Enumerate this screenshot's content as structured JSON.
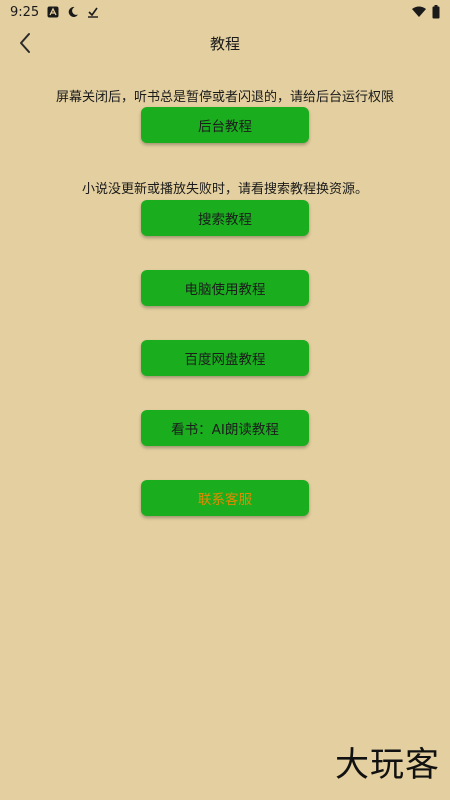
{
  "status_bar": {
    "time": "9:25",
    "left_icons": [
      "a-letter-icon",
      "night-mode-icon",
      "check-download-icon"
    ],
    "right_icons": [
      "wifi-icon",
      "battery-icon"
    ]
  },
  "header": {
    "back_icon": "chevron-left-icon",
    "title": "教程"
  },
  "hints": {
    "background": "屏幕关闭后，听书总是暂停或者闪退的，请给后台运行权限",
    "source": "小说没更新或播放失败时，请看搜索教程换资源。"
  },
  "buttons": {
    "background_tutorial": "后台教程",
    "search_tutorial": "搜索教程",
    "pc_tutorial": "电脑使用教程",
    "baidu_pan_tutorial": "百度网盘教程",
    "ai_reading_tutorial": "看书：AI朗读教程",
    "contact_support": "联系客服"
  },
  "watermark": "大玩客",
  "colors": {
    "background": "#e3cf9f",
    "button": "#1aae1f",
    "contact_text": "#e38a00"
  }
}
